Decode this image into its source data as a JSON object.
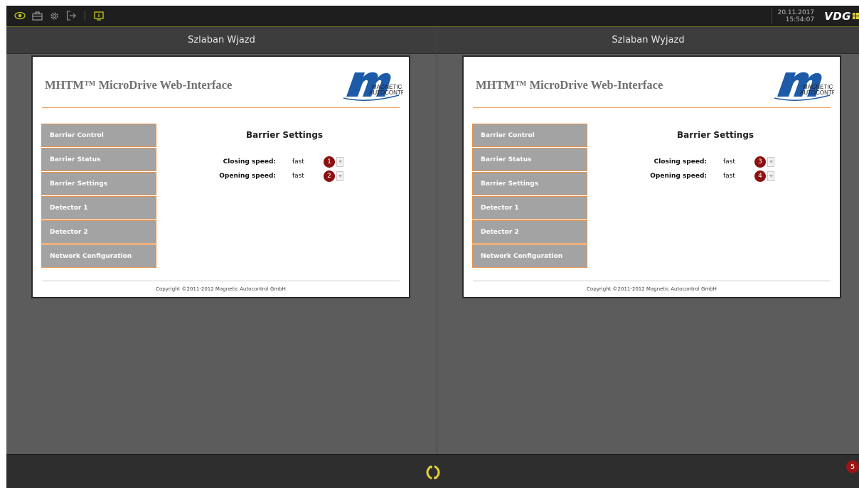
{
  "toolbar": {
    "icons": [
      "eye-icon",
      "briefcase-icon",
      "gear-icon",
      "logout-icon",
      "monitor-icon"
    ],
    "date": "20.11.2017",
    "time": "15:54:07",
    "brand": "VDG"
  },
  "colors": {
    "accent": "#c8c81e",
    "badge": "#8b1111",
    "menu_border": "#e8924a",
    "menu_bg": "#a3a3a3"
  },
  "panes": [
    {
      "header": "Szlaban Wjazd",
      "web": {
        "title": "MHTM™ MicroDrive Web-Interface",
        "logo_text_1": "MAGNETIC",
        "logo_text_2": "AUTOCONTROL",
        "menu": [
          "Barrier Control",
          "Barrier Status",
          "Barrier Settings",
          "Detector 1",
          "Detector 2",
          "Network Configuration"
        ],
        "settings_title": "Barrier Settings",
        "settings": [
          {
            "label": "Closing speed:",
            "value": "fast",
            "badge": "1"
          },
          {
            "label": "Opening speed:",
            "value": "fast",
            "badge": "2"
          }
        ],
        "copyright": "Copyright ©2011-2012 Magnetic Autocontrol GmbH"
      }
    },
    {
      "header": "Szlaban Wyjazd",
      "web": {
        "title": "MHTM™ MicroDrive Web-Interface",
        "logo_text_1": "MAGNETIC",
        "logo_text_2": "AUTOCONTROL",
        "menu": [
          "Barrier Control",
          "Barrier Status",
          "Barrier Settings",
          "Detector 1",
          "Detector 2",
          "Network Configuration"
        ],
        "settings_title": "Barrier Settings",
        "settings": [
          {
            "label": "Closing speed:",
            "value": "fast",
            "badge": "3"
          },
          {
            "label": "Opening speed:",
            "value": "fast",
            "badge": "4"
          }
        ],
        "copyright": "Copyright ©2011-2012 Magnetic Autocontrol GmbH"
      }
    }
  ],
  "footer": {
    "notification_count": "5"
  }
}
